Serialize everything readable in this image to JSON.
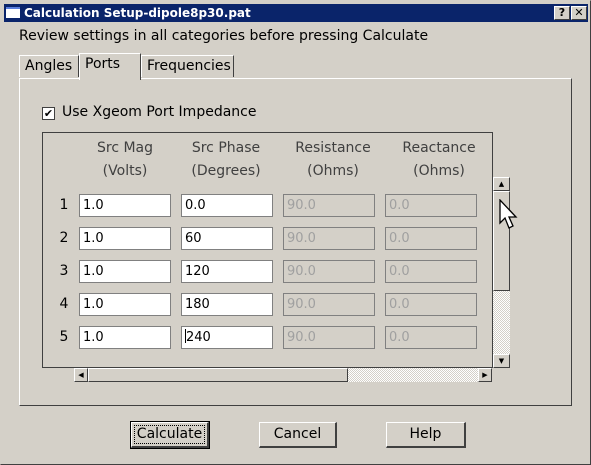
{
  "window": {
    "title": "Calculation Setup-dipole8p30.pat",
    "help_label": "?",
    "close_label": "✕"
  },
  "intro_text": "Review settings in all categories before pressing Calculate",
  "tabs": [
    {
      "label": "Angles",
      "active": false
    },
    {
      "label": "Ports",
      "active": true
    },
    {
      "label": "Frequencies",
      "active": false
    }
  ],
  "ports": {
    "use_xgeom_label": "Use Xgeom Port Impedance",
    "use_xgeom_checked": true,
    "check_mark": "✔",
    "columns": [
      {
        "line1": "Src Mag",
        "line2": "(Volts)"
      },
      {
        "line1": "Src Phase",
        "line2": "(Degrees)"
      },
      {
        "line1": "Resistance",
        "line2": "(Ohms)"
      },
      {
        "line1": "Reactance",
        "line2": "(Ohms)"
      }
    ],
    "rows": [
      {
        "num": "1",
        "mag": "1.0",
        "phase": "0.0",
        "resistance": "90.0",
        "reactance": "0.0"
      },
      {
        "num": "2",
        "mag": "1.0",
        "phase": "60",
        "resistance": "90.0",
        "reactance": "0.0"
      },
      {
        "num": "3",
        "mag": "1.0",
        "phase": "120",
        "resistance": "90.0",
        "reactance": "0.0"
      },
      {
        "num": "4",
        "mag": "1.0",
        "phase": "180",
        "resistance": "90.0",
        "reactance": "0.0"
      },
      {
        "num": "5",
        "mag": "1.0",
        "phase": "240",
        "resistance": "90.0",
        "reactance": "0.0"
      }
    ]
  },
  "buttons": {
    "calculate": "Calculate",
    "cancel": "Cancel",
    "help": "Help"
  },
  "icons": {
    "title_icon": "window-icon",
    "scroll_up": "arrow-up-icon",
    "scroll_down": "arrow-down-icon",
    "scroll_left": "arrow-left-icon",
    "scroll_right": "arrow-right-icon",
    "cursor": "mouse-pointer-icon"
  },
  "colors": {
    "title_bar": "#0a246a",
    "face": "#d4d0c8"
  }
}
